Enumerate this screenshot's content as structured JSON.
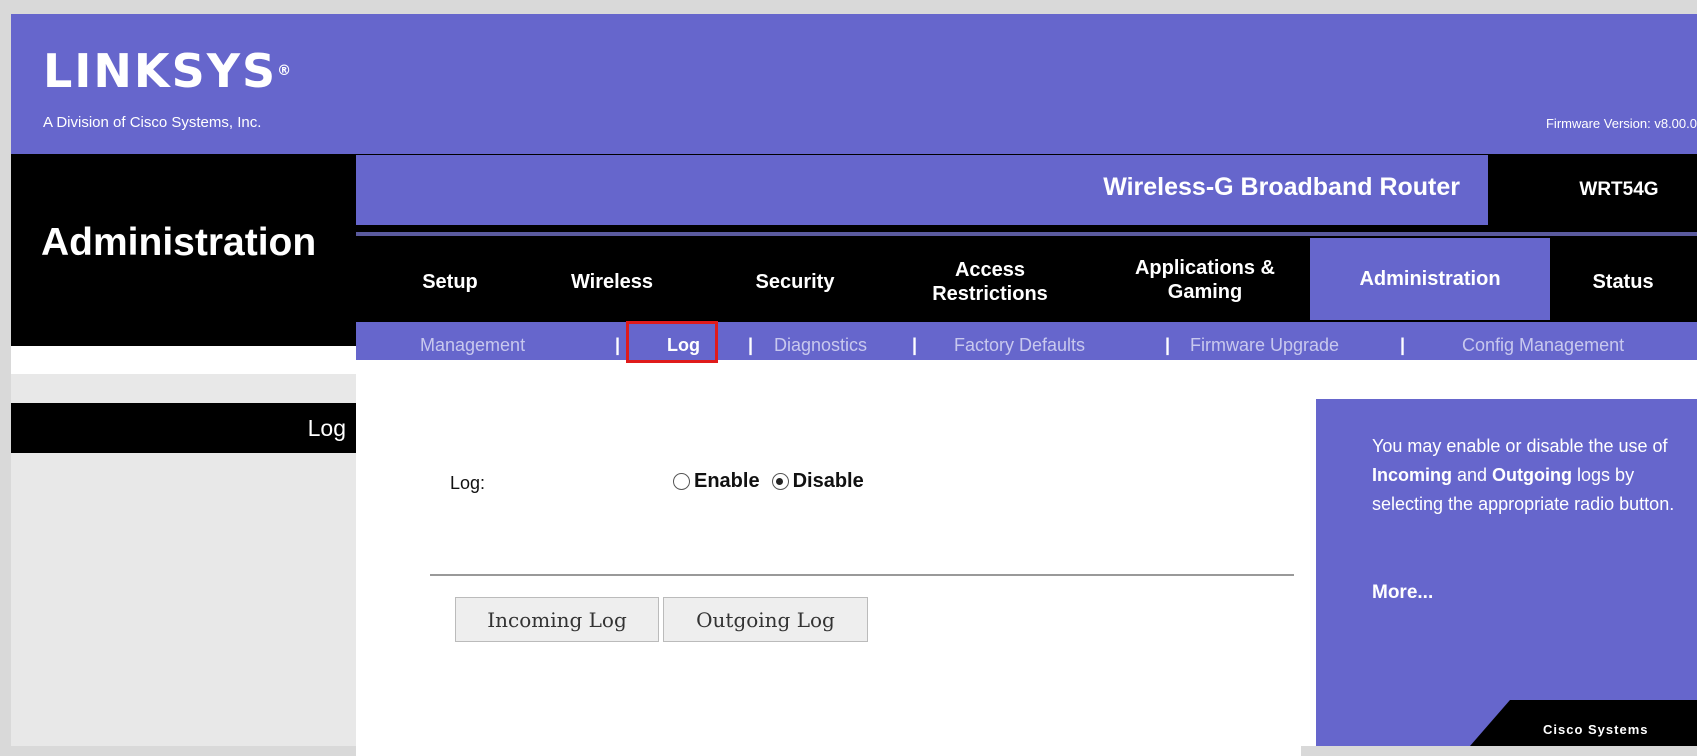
{
  "header": {
    "logo": "LINKSYS",
    "logo_mark": "®",
    "division": "A Division of Cisco Systems, Inc.",
    "firmware": "Firmware Version: v8.00.0"
  },
  "product": {
    "name": "Wireless-G Broadband Router",
    "model": "WRT54G"
  },
  "section_title": "Administration",
  "tabs": [
    {
      "label": "Setup"
    },
    {
      "label": "Wireless"
    },
    {
      "label": "Security"
    },
    {
      "label": "Access Restrictions"
    },
    {
      "label": "Applications & Gaming"
    },
    {
      "label": "Administration",
      "active": true
    },
    {
      "label": "Status"
    }
  ],
  "subnav": {
    "items": [
      {
        "label": "Management"
      },
      {
        "label": "Log",
        "active": true
      },
      {
        "label": "Diagnostics"
      },
      {
        "label": "Factory Defaults"
      },
      {
        "label": "Firmware Upgrade"
      },
      {
        "label": "Config Management"
      }
    ],
    "separator": "|"
  },
  "sidebar": {
    "label": "Log"
  },
  "form": {
    "log_label": "Log:",
    "options": [
      {
        "label": "Enable",
        "checked": false
      },
      {
        "label": "Disable",
        "checked": true
      }
    ],
    "buttons": {
      "incoming": "Incoming Log",
      "outgoing": "Outgoing Log"
    }
  },
  "help": {
    "line1": "You may enable or disable the use of ",
    "bold1": "Incoming",
    "line2": " and ",
    "bold2": "Outgoing",
    "line3": " logs by selecting the appropriate radio button.",
    "more": "More..."
  },
  "footer_brand": "Cisco Systems",
  "colors": {
    "brand_purple": "#6666cc",
    "band_black": "#000000",
    "highlight_red": "#e01b1b"
  }
}
